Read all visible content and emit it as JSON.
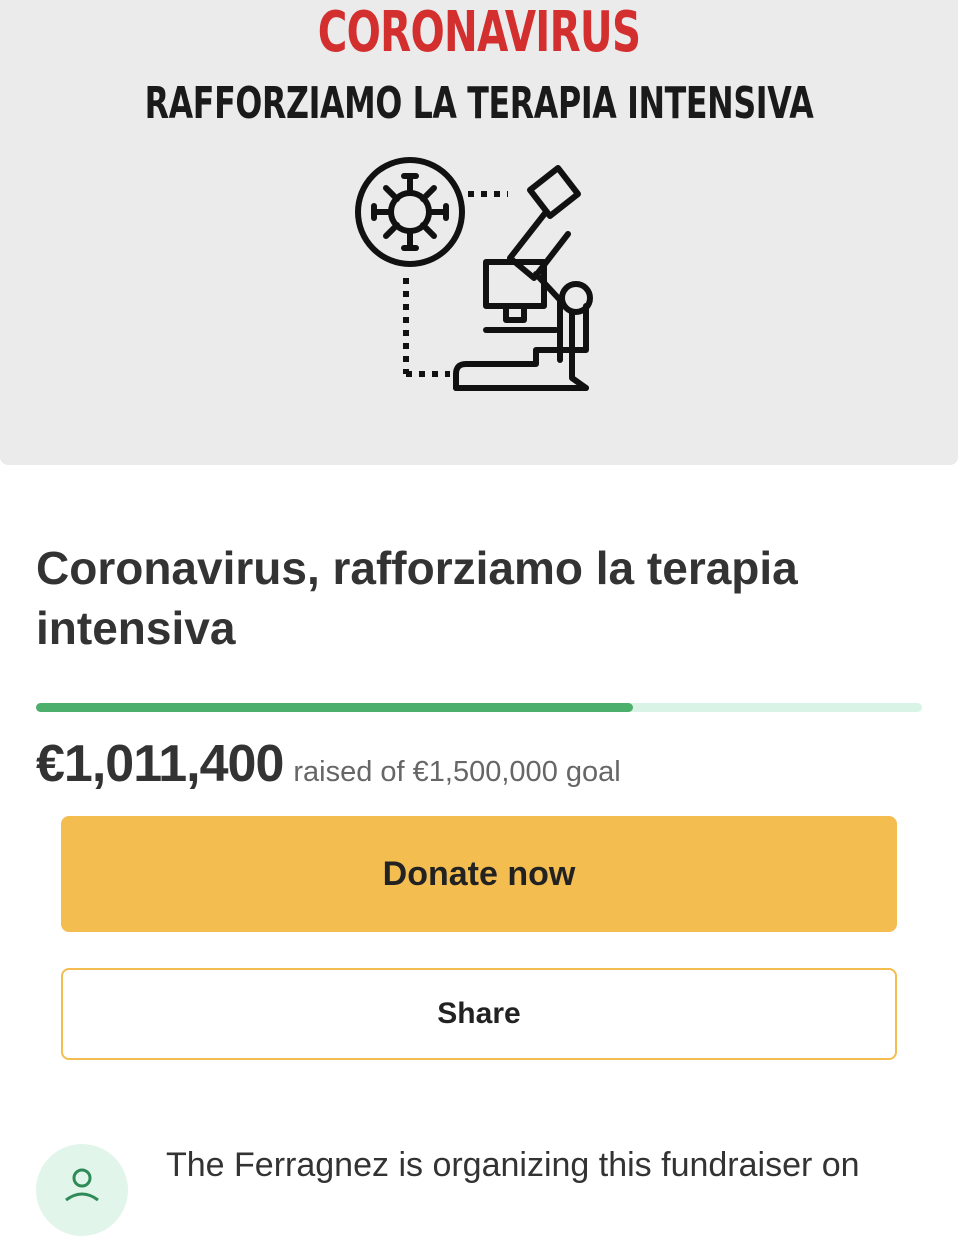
{
  "hero": {
    "title": "CORONAVIRUS",
    "subtitle": "RAFFORZIAMO LA TERAPIA INTENSIVA",
    "illustration_icons": [
      "virus-icon",
      "microscope-icon"
    ]
  },
  "campaign": {
    "title": "Coronavirus, rafforziamo la terapia intensiva",
    "progress_fraction": 0.674
  },
  "funding": {
    "raised": "€1,011,400",
    "goal_text": "raised of €1,500,000 goal"
  },
  "buttons": {
    "donate_label": "Donate now",
    "share_label": "Share"
  },
  "organizer": {
    "text": "The Ferragnez is organizing this fundraiser on",
    "avatar_icon": "user-icon"
  },
  "colors": {
    "hero_red": "#d32f2f",
    "progress_green": "#4caf6b",
    "progress_track": "#d9f3e6",
    "donate_yellow": "#f3bd50"
  }
}
